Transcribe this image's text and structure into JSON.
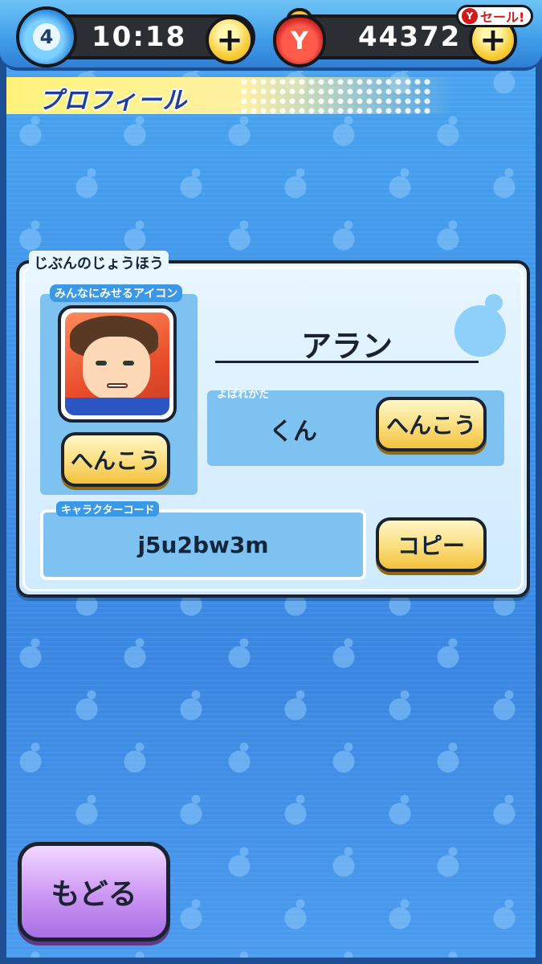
{
  "status_bar": {
    "stamina_level": "4",
    "timer": "10:18",
    "money": "44372",
    "sale_badge": "セール!",
    "sale_badge_mark": "Y",
    "purse_mark": "Y"
  },
  "page": {
    "title": "プロフィール"
  },
  "profile": {
    "section_label": "じぶんのじょうほう",
    "icon_label": "みんなにみせるアイコン",
    "icon_change_button": "へんこう",
    "player_name": "アラン",
    "honorific_label": "よばれかた",
    "honorific_value": "くん",
    "honorific_change_button": "へんこう",
    "code_label": "キャラクターコード",
    "character_code": "j5u2bw3m",
    "copy_button": "コピー"
  },
  "footer": {
    "back_button": "もどる"
  },
  "colors": {
    "background": "#3f93ea",
    "panel": "#e8f6ff",
    "button_yellow": "#fce38a",
    "back_button_purple": "#cf9bf5",
    "title_text": "#1f3e9a"
  }
}
